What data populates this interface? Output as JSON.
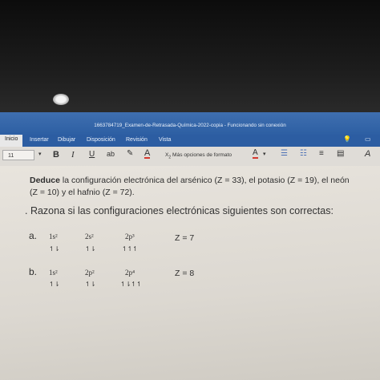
{
  "window": {
    "title": "1663784719_Examen-de-Retrasada-Química-2022-copia - Funcionando sin conexión"
  },
  "menu": {
    "items": [
      "Inicio",
      "Insertar",
      "Dibujar",
      "Disposición",
      "Revisión",
      "Vista"
    ]
  },
  "toolbar": {
    "font_size": "11",
    "bold": "B",
    "italic": "I",
    "underline": "U",
    "strike": "ab",
    "font_color_letter": "A",
    "more_format": "Más opciones de formato"
  },
  "document": {
    "para1_bold": "Deduce",
    "para1_rest": " la configuración electrónica del arsénico (Z = 33), el potasio (Z = 19), el neón",
    "para2": "(Z = 10) y el hafnio (Z = 72).",
    "para3": ". Razona si las configuraciones electrónicas siguientes son correctas:",
    "options": [
      {
        "label": "a.",
        "orbitals": [
          "1s²",
          "2s²",
          "2p³"
        ],
        "arrows": [
          "↿⇂",
          "↿⇂",
          "↿↿↿"
        ],
        "z": "Z = 7"
      },
      {
        "label": "b.",
        "orbitals": [
          "1s²",
          "2p²",
          "2p⁴"
        ],
        "arrows": [
          "↿⇂",
          "↿⇂",
          "↿⇂↿↿"
        ],
        "z": "Z = 8"
      }
    ]
  },
  "colors": {
    "ribbon": "#2c5da2",
    "toolbar": "#dfdcd7",
    "paper": "#e6e2db",
    "font_color_accent": "#d43a2f"
  }
}
